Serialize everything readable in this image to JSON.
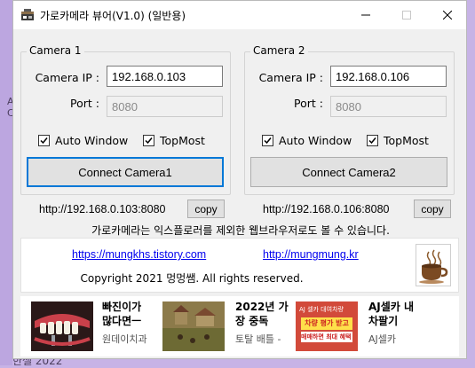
{
  "window": {
    "title": "가로카메라 뷰어(V1.0) (일반용)"
  },
  "camera1": {
    "legend": "Camera 1",
    "ip_label": "Camera IP :",
    "ip_value": "192.168.0.103",
    "port_label": "Port :",
    "port_value": "8080",
    "auto_window_label": "Auto Window",
    "topmost_label": "TopMost",
    "connect_label": "Connect Camera1",
    "url": "http://192.168.0.103:8080",
    "copy_label": "copy"
  },
  "camera2": {
    "legend": "Camera 2",
    "ip_label": "Camera IP :",
    "ip_value": "192.168.0.106",
    "port_label": "Port :",
    "port_value": "8080",
    "auto_window_label": "Auto Window",
    "topmost_label": "TopMost",
    "connect_label": "Connect Camera2",
    "url": "http://192.168.0.106:8080",
    "copy_label": "copy"
  },
  "notice": "가로카메라는 익스플로러를 제외한 웹브라우저로도 볼 수 있습니다.",
  "links": {
    "tistory": "https://mungkhs.tistory.com",
    "site": "http://mungmung.kr",
    "copyright": "Copyright 2021 멍멍쌤. All rights reserved."
  },
  "ads": [
    {
      "title_line1": "빠진이가",
      "title_line2": "많다면ㅡ",
      "subtitle": "원데이치과"
    },
    {
      "title_line1": "2022년 가",
      "title_line2": "장 중독",
      "subtitle": "토탈 배틀 -"
    },
    {
      "badge": "AJ 셀카 대여차량",
      "banner_line1": "차량 평가 받고",
      "banner_line2": "매매하면 최대 혜택 추가",
      "title_line1": "AJ셀카 내",
      "title_line2": "차팔기",
      "subtitle": "AJ셀카"
    }
  ],
  "background": {
    "fragment_bottom": "한셀 2022"
  },
  "colors": {
    "focus_border": "#0078d7",
    "link": "#0000ee",
    "window_bg": "#f0f0f0",
    "desktop_bg": "#c7b3e6"
  }
}
